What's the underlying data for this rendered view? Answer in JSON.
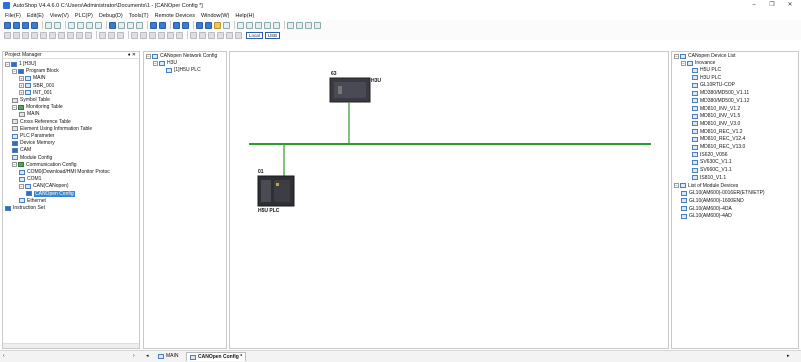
{
  "window": {
    "title": "AutoShop V4.4.6.0  C:\\Users\\Administrator\\Documents\\1 - [CANOper Config *]",
    "minimize": "–",
    "maximize": "❐",
    "close": "✕"
  },
  "menu": [
    "File(F)",
    "Edit(E)",
    "View(V)",
    "PLC(P)",
    "Debug(D)",
    "Tools(T)",
    "Remote Devices",
    "Window(W)",
    "Help(H)"
  ],
  "toolbar": {
    "local_label": "Local",
    "usb_label": "USB"
  },
  "project_manager": {
    "title": "Project Manager",
    "pin": "♦ ✕",
    "tree": [
      {
        "label": "1 [H3U]",
        "indent": 0,
        "icon": "computer-icon"
      },
      {
        "label": "Program Block",
        "indent": 1,
        "icon": "folder-icon"
      },
      {
        "label": "MAIN",
        "indent": 2,
        "icon": "ladder-icon"
      },
      {
        "label": "SBR_001",
        "indent": 2,
        "icon": "ladder-icon"
      },
      {
        "label": "INT_001",
        "indent": 2,
        "icon": "ladder-icon"
      },
      {
        "label": "Symbol Table",
        "indent": 1,
        "icon": "table-icon"
      },
      {
        "label": "Monitoring Table",
        "indent": 1,
        "icon": "monitor-icon"
      },
      {
        "label": "MAIN",
        "indent": 2,
        "icon": "table-icon"
      },
      {
        "label": "Cross Reference Table",
        "indent": 1,
        "icon": "table-icon"
      },
      {
        "label": "Element Using Information Table",
        "indent": 1,
        "icon": "table-icon"
      },
      {
        "label": "PLC Parameter",
        "indent": 1,
        "icon": "param-icon"
      },
      {
        "label": "Device Memory",
        "indent": 1,
        "icon": "memory-icon"
      },
      {
        "label": "CAM",
        "indent": 1,
        "icon": "cam-icon"
      },
      {
        "label": "Module Config",
        "indent": 1,
        "icon": "module-icon"
      },
      {
        "label": "Communication Config",
        "indent": 1,
        "icon": "comm-icon"
      },
      {
        "label": "COM0(Download/HMI Monitor Protoc",
        "indent": 2,
        "icon": "port-icon"
      },
      {
        "label": "COM1",
        "indent": 2,
        "icon": "port-icon"
      },
      {
        "label": "CAN(CANopen)",
        "indent": 2,
        "icon": "can-icon"
      },
      {
        "label": "CANOpen Config",
        "indent": 3,
        "icon": "config-icon",
        "selected": true
      },
      {
        "label": "Ethernet",
        "indent": 2,
        "icon": "ethernet-icon"
      },
      {
        "label": "Instruction Set",
        "indent": 0,
        "icon": "computer-icon"
      }
    ]
  },
  "network_tree": {
    "root": "CANopen Network Config",
    "items": [
      "H3U",
      "[1]H5U PLC"
    ]
  },
  "canvas": {
    "device_top": {
      "station": "63",
      "name": "H3U"
    },
    "device_bottom": {
      "station": "01",
      "name": "H5U PLC"
    },
    "bus_color": "#2e9b2e"
  },
  "device_list": {
    "root": "CANopen Device List",
    "inovance": "Inovance",
    "items": [
      "H5U PLC",
      "H3U PLC",
      "GL10RTU-COP",
      "MD380/MD500_V1.11",
      "MD380/MD500_V1.12",
      "MD810_INV_V1.2",
      "MD810_INV_V1.5",
      "MD810_INV_V3.0",
      "MD810_REC_V1.2",
      "MD810_REC_V12.4",
      "MD810_REC_V13.0",
      "IS620_V056",
      "SV630C_V1.1",
      "SV660C_V1.1",
      "IS810_V1.1"
    ],
    "modules_root": "List of Module Devices",
    "modules": [
      "GL10(AM600)-0016ER(ETN/ETP)",
      "GL10(AM600)-1600END",
      "GL10(AM600)-4DA",
      "GL10(AM600)-4AD"
    ]
  },
  "tabs": [
    {
      "label": "MAIN",
      "active": false
    },
    {
      "label": "CANOpen Config *",
      "active": true
    }
  ]
}
